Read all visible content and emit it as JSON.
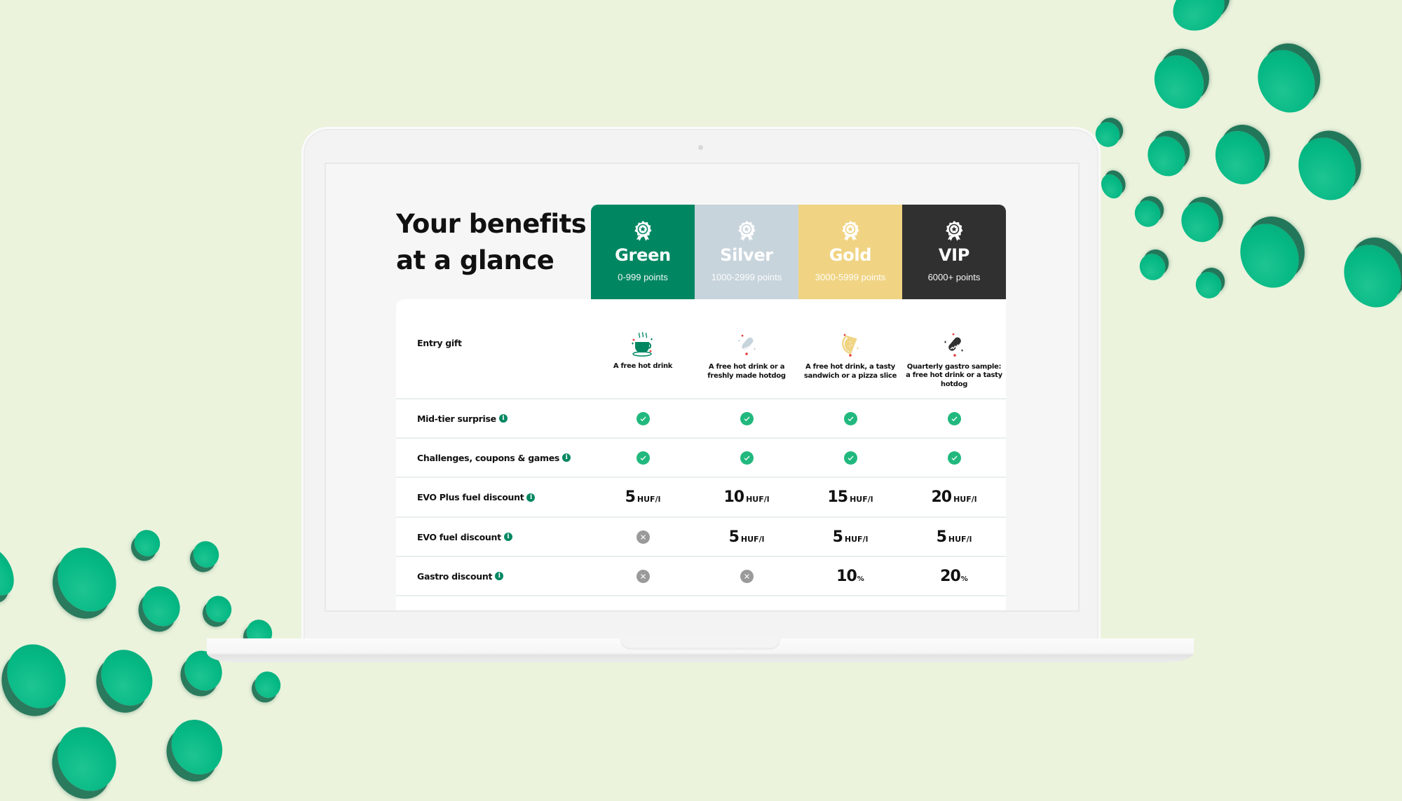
{
  "page": {
    "title_line1": "Your benefits",
    "title_line2": "at a glance"
  },
  "tiers": [
    {
      "name": "Green",
      "points": "0-999 points",
      "color": "#008762",
      "icon": "award-badge-icon"
    },
    {
      "name": "Silver",
      "points": "1000-2999 points",
      "color": "#c8d4dc",
      "icon": "award-badge-icon"
    },
    {
      "name": "Gold",
      "points": "3000-5999 points",
      "color": "#f0d483",
      "icon": "award-badge-icon"
    },
    {
      "name": "VIP",
      "points": "6000+ points",
      "color": "#303030",
      "icon": "award-badge-icon"
    }
  ],
  "benefits": {
    "entry_gift": {
      "label": "Entry gift",
      "cells": [
        {
          "icon": "hot-drink-cup-icon",
          "text": "A free hot drink"
        },
        {
          "icon": "hotdog-icon",
          "text": "A free hot drink or a freshly made hotdog"
        },
        {
          "icon": "sandwich-icon",
          "text": "A free hot drink, a tasty sandwich or a pizza slice"
        },
        {
          "icon": "hotdog-icon",
          "text": "Quarterly gastro sample: a free hot drink or a tasty hotdog"
        }
      ]
    },
    "mid_tier_surprise": {
      "label": "Mid-tier surprise",
      "cells": [
        "check",
        "check",
        "check",
        "check"
      ]
    },
    "challenges": {
      "label": "Challenges, coupons & games",
      "cells": [
        "check",
        "check",
        "check",
        "check"
      ]
    },
    "evo_plus": {
      "label": "EVO Plus fuel discount",
      "cells": [
        {
          "value": "5",
          "unit": "HUF/l"
        },
        {
          "value": "10",
          "unit": "HUF/l"
        },
        {
          "value": "15",
          "unit": "HUF/l"
        },
        {
          "value": "20",
          "unit": "HUF/l"
        }
      ]
    },
    "evo": {
      "label": "EVO fuel discount",
      "cells": [
        "cross",
        {
          "value": "5",
          "unit": "HUF/l"
        },
        {
          "value": "5",
          "unit": "HUF/l"
        },
        {
          "value": "5",
          "unit": "HUF/l"
        }
      ]
    },
    "gastro": {
      "label": "Gastro discount",
      "cells": [
        "cross",
        "cross",
        {
          "value": "10",
          "unit": "%"
        },
        {
          "value": "20",
          "unit": "%"
        }
      ]
    }
  },
  "icons": {
    "info": "i"
  },
  "colors": {
    "background": "#ebf3dd",
    "brand_green": "#008762",
    "check_green": "#21b87e",
    "cross_grey": "#9a9a9a",
    "coin_green": "#05b884"
  }
}
